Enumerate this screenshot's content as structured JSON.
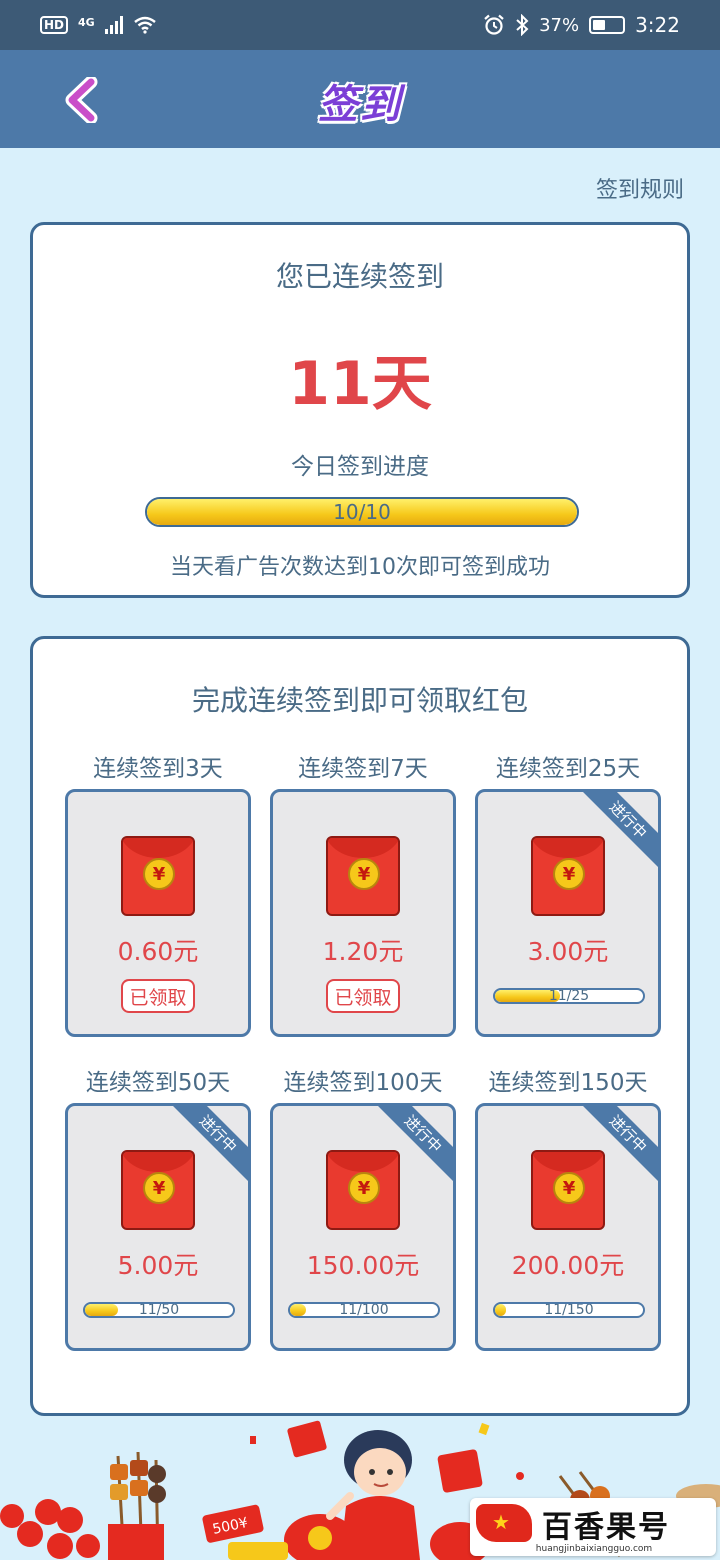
{
  "status_bar": {
    "hd_badge": "HD",
    "network": "4G",
    "battery_percent": "37%",
    "time": "3:22"
  },
  "header": {
    "title": "签到",
    "back_icon": "chevron-left-icon"
  },
  "rules_link": "签到规则",
  "streak_card": {
    "label": "您已连续签到",
    "days": "11天",
    "progress_label": "今日签到进度",
    "progress_text": "10/10",
    "progress_fraction": 1.0,
    "hint": "当天看广告次数达到10次即可签到成功"
  },
  "rewards_card": {
    "title": "完成连续签到即可领取红包",
    "tiers": [
      {
        "label": "连续签到3天",
        "amount": "0.60元",
        "status": "claimed",
        "button": "已领取"
      },
      {
        "label": "连续签到7天",
        "amount": "1.20元",
        "status": "claimed",
        "button": "已领取"
      },
      {
        "label": "连续签到25天",
        "amount": "3.00元",
        "status": "in_progress",
        "ribbon": "进行中",
        "progress_text": "11/25",
        "progress_fraction": 0.44
      },
      {
        "label": "连续签到50天",
        "amount": "5.00元",
        "status": "in_progress",
        "ribbon": "进行中",
        "progress_text": "11/50",
        "progress_fraction": 0.22
      },
      {
        "label": "连续签到100天",
        "amount": "150.00元",
        "status": "in_progress",
        "ribbon": "进行中",
        "progress_text": "11/100",
        "progress_fraction": 0.11
      },
      {
        "label": "连续签到150天",
        "amount": "200.00元",
        "status": "in_progress",
        "ribbon": "进行中",
        "progress_text": "11/150",
        "progress_fraction": 0.073
      }
    ],
    "envelope_symbol": "¥"
  },
  "decor": {
    "coupon_text": "500¥"
  },
  "watermark": {
    "brand": "百香果号",
    "url": "huangjinbaixiangguo.com"
  },
  "colors": {
    "accent_red": "#e0464a",
    "header_blue": "#4d79a8",
    "status_bar": "#3d5a76",
    "title_purple": "#7b3fd6",
    "background": "#d9f0fb"
  }
}
